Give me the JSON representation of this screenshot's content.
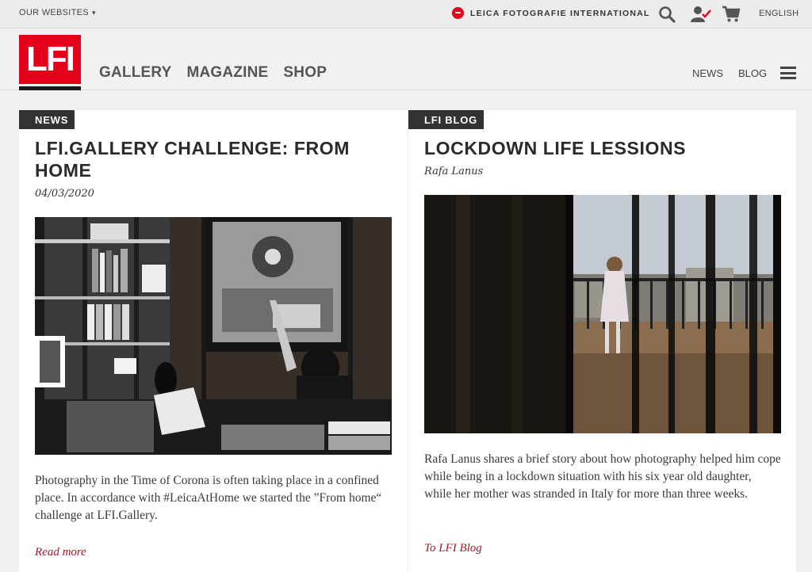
{
  "topbar": {
    "our_websites": "OUR WEBSITES",
    "caret": "▾",
    "brand_link": "LEICA FOTOGRAFIE INTERNATIONAL",
    "language": "ENGLISH"
  },
  "header": {
    "logo_text": "LFI",
    "main_nav": [
      "GALLERY",
      "MAGAZINE",
      "SHOP"
    ],
    "sub_nav": [
      "NEWS",
      "BLOG"
    ]
  },
  "cards": [
    {
      "badge": "NEWS",
      "title": "LFI.GALLERY CHALLENGE: FROM HOME",
      "meta": "04/03/2020",
      "image": "black-and-white photo of a person in a mask at a desk in a study",
      "teaser": "Photography in the Time of Corona is often taking place in a confined place. In accordance with #LeicaAtHome we started the ”From home“ challenge at LFI.Gallery.",
      "link": "Read more"
    },
    {
      "badge": "LFI BLOG",
      "title": "LOCKDOWN LIFE LESSIONS",
      "meta": "Rafa Lanus",
      "image": "girl on a balcony seen through window bars",
      "teaser": "Rafa Lanus shares a brief story about how photography helped him cope while being in a lockdown situation with his six year old daughter, while her mother was stranded in Italy for more than three weeks.",
      "link": "To LFI Blog"
    }
  ],
  "icons": {
    "search": "search-icon",
    "account": "user-check-icon",
    "cart": "cart-icon",
    "menu": "hamburger-menu-icon"
  },
  "colors": {
    "brand_red": "#e2001a",
    "badge_bg": "#333333",
    "link_red": "#a0192a"
  }
}
